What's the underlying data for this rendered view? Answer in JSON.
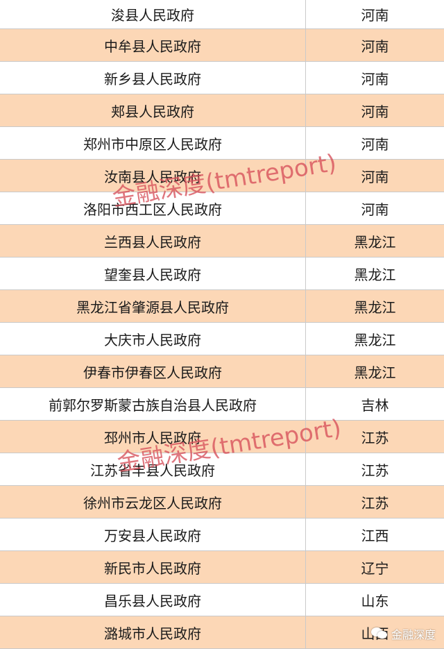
{
  "table": {
    "rows": [
      {
        "name": "浚县人民政府",
        "province": "河南"
      },
      {
        "name": "中牟县人民政府",
        "province": "河南"
      },
      {
        "name": "新乡县人民政府",
        "province": "河南"
      },
      {
        "name": "郏县人民政府",
        "province": "河南"
      },
      {
        "name": "郑州市中原区人民政府",
        "province": "河南"
      },
      {
        "name": "汝南县人民政府",
        "province": "河南"
      },
      {
        "name": "洛阳市西工区人民政府",
        "province": "河南"
      },
      {
        "name": "兰西县人民政府",
        "province": "黑龙江"
      },
      {
        "name": "望奎县人民政府",
        "province": "黑龙江"
      },
      {
        "name": "黑龙江省肇源县人民政府",
        "province": "黑龙江"
      },
      {
        "name": "大庆市人民政府",
        "province": "黑龙江"
      },
      {
        "name": "伊春市伊春区人民政府",
        "province": "黑龙江"
      },
      {
        "name": "前郭尔罗斯蒙古族自治县人民政府",
        "province": "吉林"
      },
      {
        "name": "邳州市人民政府",
        "province": "江苏"
      },
      {
        "name": "江苏省丰县人民政府",
        "province": "江苏"
      },
      {
        "name": "徐州市云龙区人民政府",
        "province": "江苏"
      },
      {
        "name": "万安县人民政府",
        "province": "江西"
      },
      {
        "name": "新民市人民政府",
        "province": "辽宁"
      },
      {
        "name": "昌乐县人民政府",
        "province": "山东"
      },
      {
        "name": "潞城市人民政府",
        "province": "山西"
      }
    ]
  },
  "watermark": {
    "text": "金融深度(tmtreport)"
  },
  "brand": {
    "icon": "wechat-icon",
    "text": "金融深度"
  },
  "colors": {
    "row_highlight": "#fcd7b6",
    "watermark": "#d6505a"
  }
}
